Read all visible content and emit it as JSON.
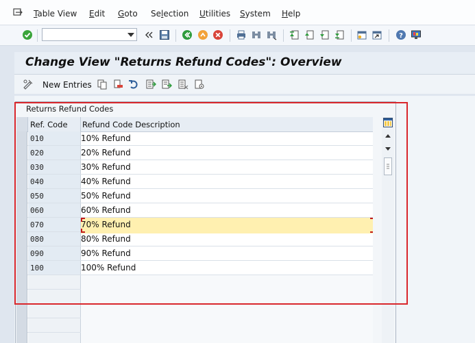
{
  "menubar": {
    "items": [
      {
        "label": "Table View",
        "u": "T"
      },
      {
        "label": "Edit",
        "u": "E"
      },
      {
        "label": "Goto",
        "u": "G"
      },
      {
        "label": "Selection",
        "u": "l"
      },
      {
        "label": "Utilities",
        "u": "U"
      },
      {
        "label": "System",
        "u": "S"
      },
      {
        "label": "Help",
        "u": "H"
      }
    ]
  },
  "toolbar": {
    "command_field_value": "",
    "icons": [
      "enter-check-icon",
      "save-icon",
      "back-icon",
      "exit-icon",
      "cancel-icon",
      "print-icon",
      "find-icon",
      "find-next-icon",
      "first-page-icon",
      "previous-page-icon",
      "next-page-icon",
      "last-page-icon",
      "create-session-icon",
      "shortcut-icon",
      "help-icon",
      "customize-layout-icon"
    ],
    "colors": {
      "check": "#3aa43a",
      "back": "#2e9b3c",
      "exit": "#f2a23a",
      "cancel": "#d9443a"
    }
  },
  "title": "Change View \"Returns Refund Codes\": Overview",
  "app_toolbar": {
    "new_entries_label": "New Entries"
  },
  "table": {
    "title": "Returns Refund Codes",
    "columns": [
      "Ref. Code",
      "Refund Code Description"
    ],
    "rows": [
      {
        "code": "010",
        "desc": "10% Refund"
      },
      {
        "code": "020",
        "desc": "20% Refund"
      },
      {
        "code": "030",
        "desc": "30% Refund"
      },
      {
        "code": "040",
        "desc": "40% Refund"
      },
      {
        "code": "050",
        "desc": "50% Refund"
      },
      {
        "code": "060",
        "desc": "60% Refund"
      },
      {
        "code": "070",
        "desc": "70% Refund"
      },
      {
        "code": "080",
        "desc": "80% Refund"
      },
      {
        "code": "090",
        "desc": "90% Refund"
      },
      {
        "code": "100",
        "desc": "100% Refund"
      }
    ],
    "selected_row_index": 6,
    "highlight_color": "#fff0b0"
  },
  "annotation": {
    "color": "#d9262b"
  }
}
